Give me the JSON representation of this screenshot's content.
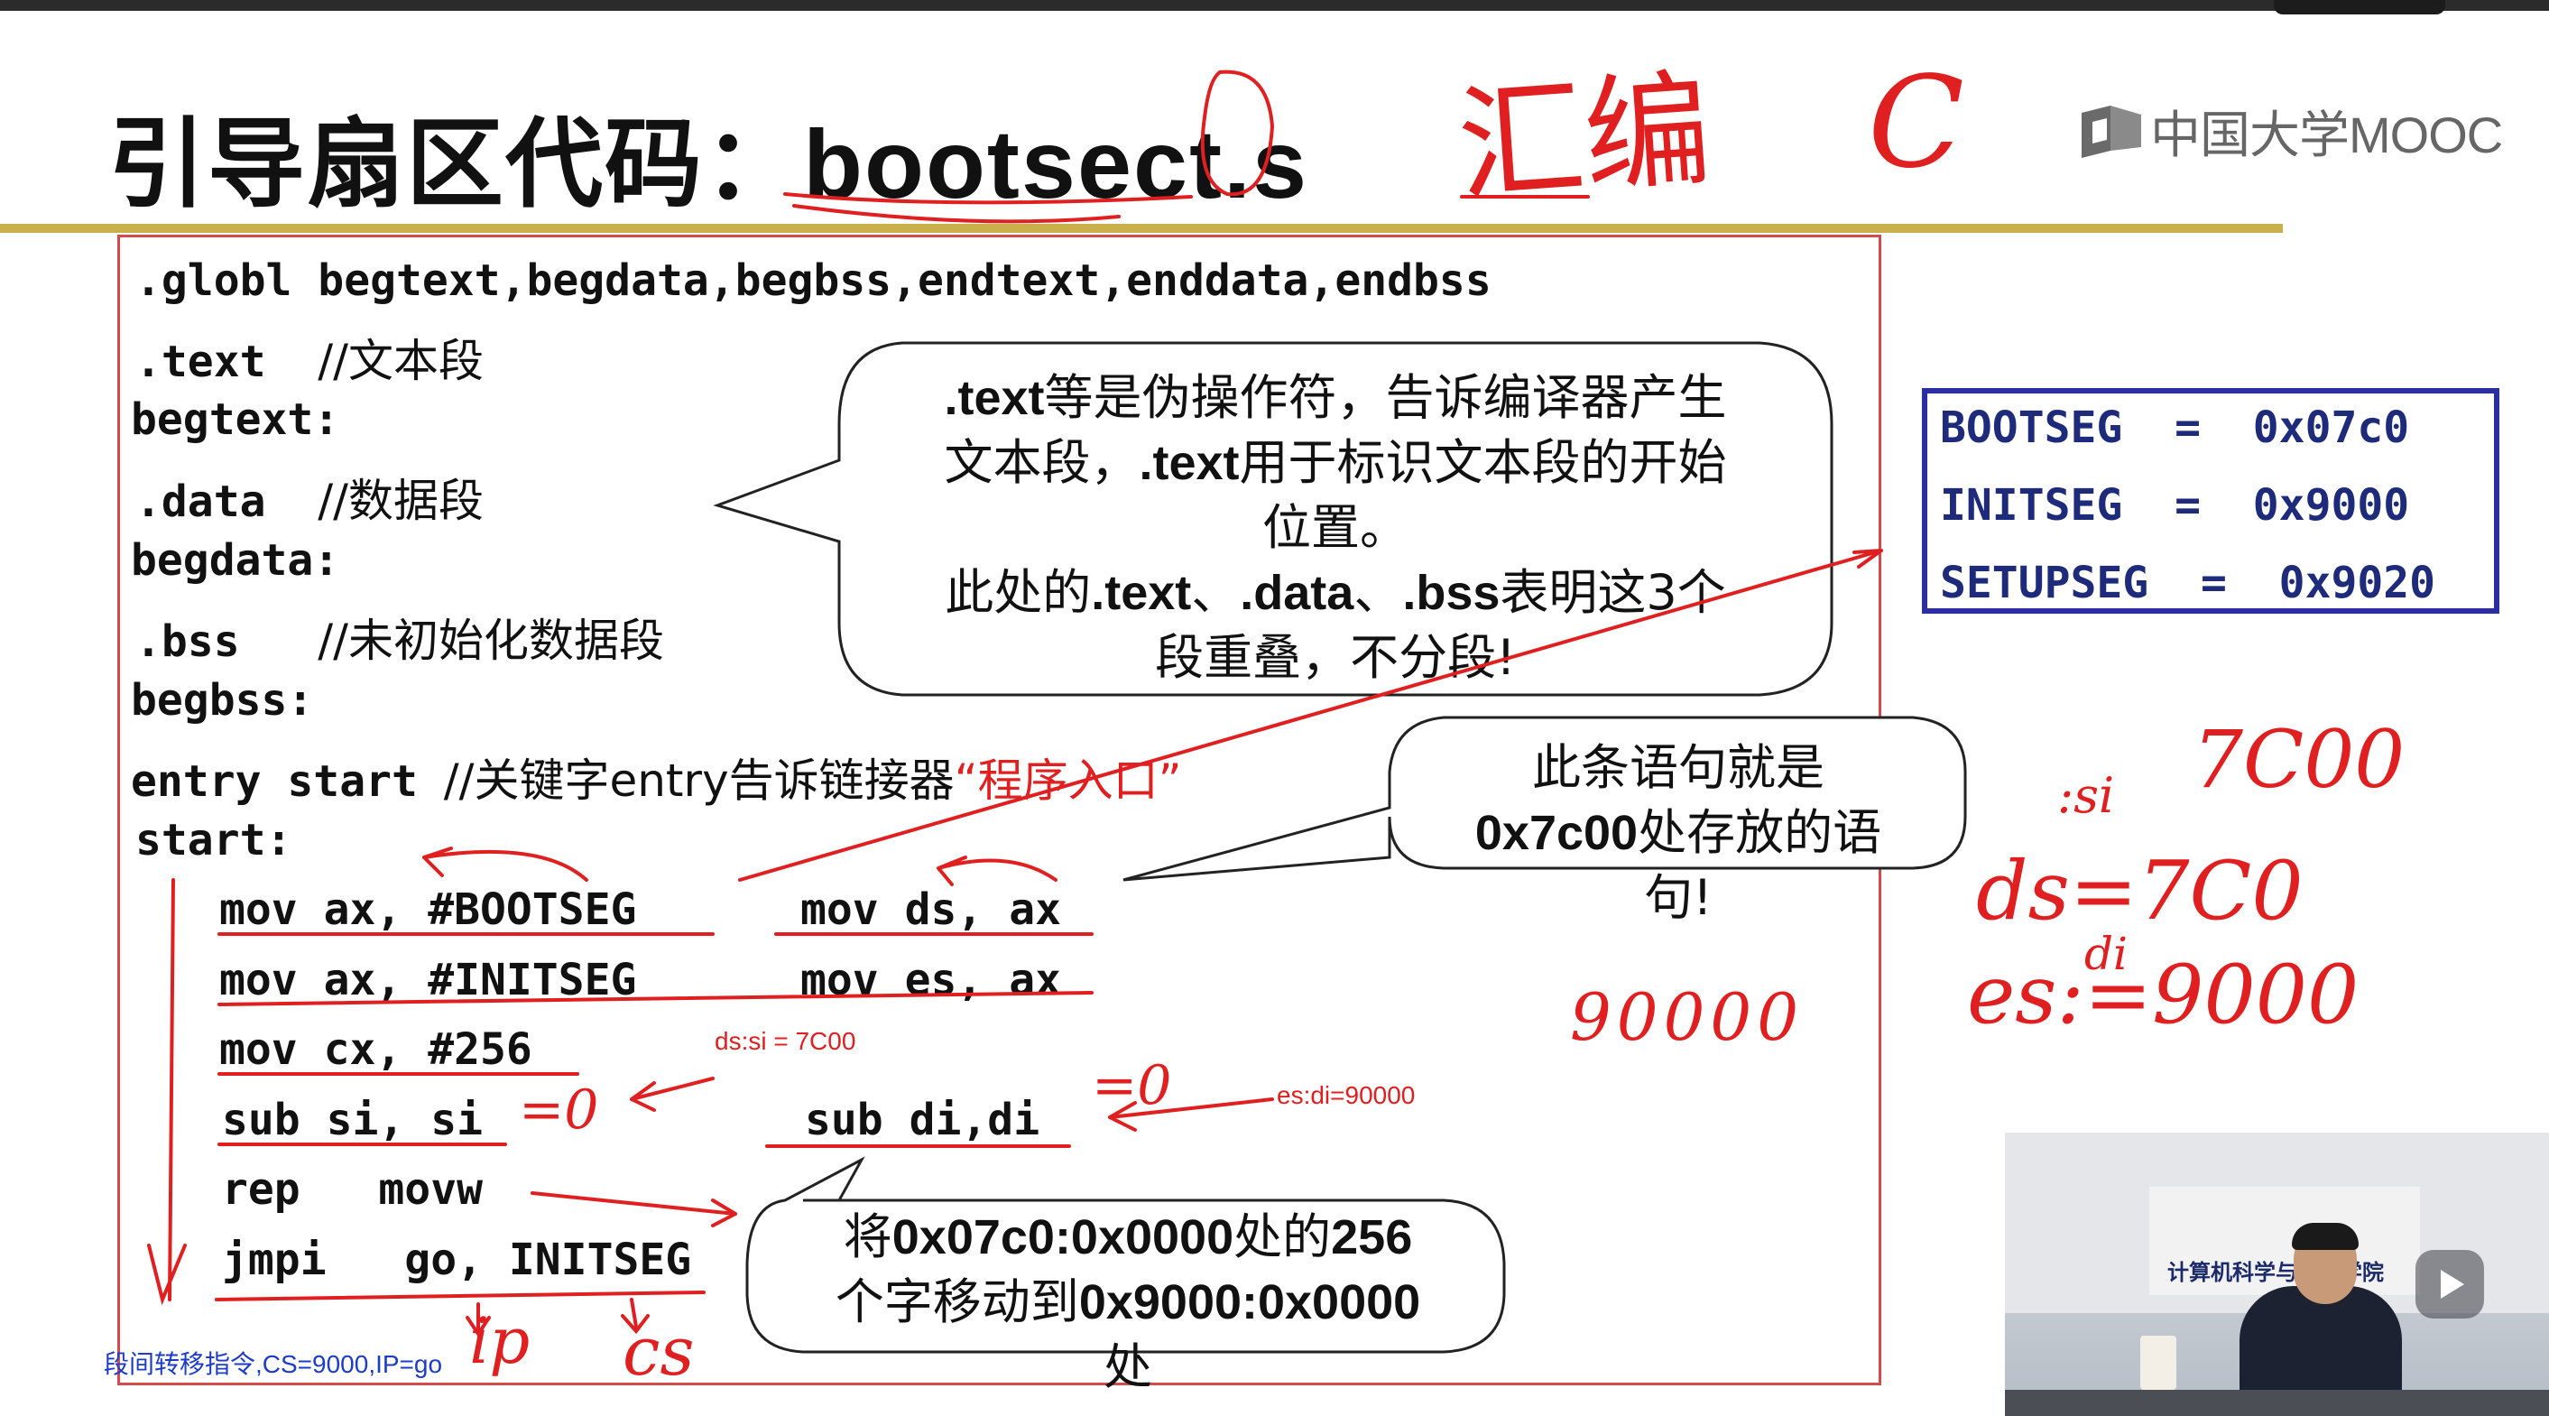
{
  "title": {
    "cn": "引导扇区代码：",
    "code": "bootsect.s"
  },
  "logo": {
    "text": "中国大学MOOC"
  },
  "code": {
    "line1": ".globl begtext,begdata,begbss,endtext,enddata,endbss",
    "line2_code": ".text  ",
    "line2_comment": "//文本段",
    "line3": "begtext:",
    "line4_code": ".data  ",
    "line4_comment": "//数据段",
    "line5": "begdata:",
    "line6_code": ".bss   ",
    "line6_comment": "//未初始化数据段",
    "line7": "begbss:",
    "line8_code": "entry start ",
    "line8_comment": "//关键字entry告诉链接器",
    "line8_red": "“程序入口”",
    "line9": "start:",
    "l10a": "mov ax, #BOOTSEG",
    "l10b": "mov ds, ax",
    "l11a": "mov ax, #INITSEG",
    "l11b": "mov es, ax",
    "l12": "mov cx, #256",
    "l13a": "sub si, si",
    "l13b": "sub di,di",
    "l14": "rep   movw",
    "l15": "jmpi   go, INITSEG"
  },
  "callouts": {
    "c1_l1_b": ".text",
    "c1_l1": "等是伪操作符，告诉编译器产生",
    "c1_l2a": "文本段，",
    "c1_l2_b": ".text",
    "c1_l2c": "用于标识文本段的开始",
    "c1_l3": "位置。",
    "c1_l4a": "此处的",
    "c1_l4_b1": ".text",
    "c1_l4_s1": "、",
    "c1_l4_b2": ".data",
    "c1_l4_s2": "、",
    "c1_l4_b3": ".bss",
    "c1_l4c": "表明这3个",
    "c1_l5": "段重叠，不分段!",
    "c2_l1": "此条语句就是",
    "c2_l2_b": "0x7c00",
    "c2_l2": "处存放的语",
    "c2_l3": "句!",
    "c3_l1a": "将",
    "c3_l1_b": "0x07c0:0x0000",
    "c3_l1c": "处的",
    "c3_l1_b2": "256",
    "c3_l2a": "个字移动到",
    "c3_l2_b": "0x9000:0x0000",
    "c3_l3": "处"
  },
  "segments": {
    "bootseg": "BOOTSEG  =  0x07c0",
    "initseg": "INITSEG  =  0x9000",
    "setupseg": "SETUPSEG  =  0x9020"
  },
  "annotations": {
    "dssi": "ds:si = 7C00",
    "esdi": "es:di=90000",
    "jmpi_note": "段间转移指令,CS=9000,IP=go"
  },
  "handwriting": {
    "huibian": "汇编",
    "c": "C",
    "eq0a": "=0",
    "eq0b": "=0",
    "n90000": "90000",
    "n7c00": "7C00",
    "si": ":si",
    "ds": "ds=7C0",
    "di": "di",
    "es": "es:=9000",
    "ip": "ip",
    "cs": "cs"
  },
  "video": {
    "banner": "计算机科学与技术学院"
  },
  "colors": {
    "accent_red": "#e02020",
    "frame_red": "#d34b4b",
    "gold": "#c9b04a",
    "seg_blue": "#2a2ea0"
  }
}
